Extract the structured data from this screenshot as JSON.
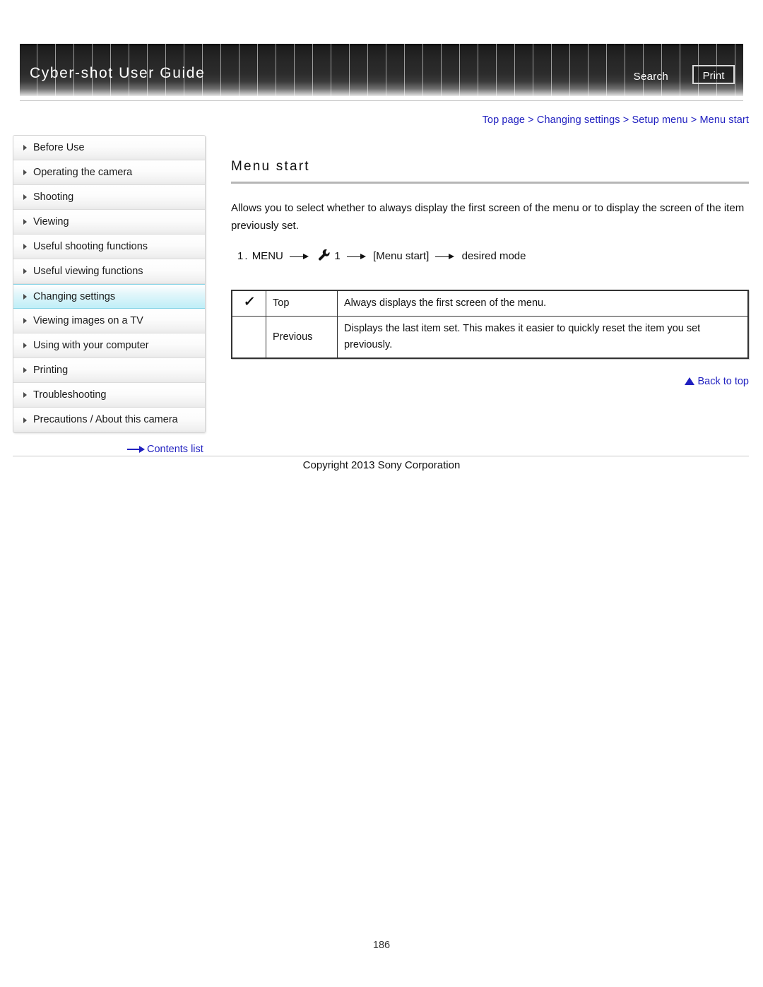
{
  "header": {
    "title": "Cyber-shot User Guide",
    "search_label": "Search",
    "print_label": "Print"
  },
  "breadcrumb": {
    "text": "Top page > Changing settings > Setup menu > Menu start"
  },
  "sidebar": {
    "items": [
      {
        "label": "Before Use",
        "active": false
      },
      {
        "label": "Operating the camera",
        "active": false
      },
      {
        "label": "Shooting",
        "active": false
      },
      {
        "label": "Viewing",
        "active": false
      },
      {
        "label": "Useful shooting functions",
        "active": false
      },
      {
        "label": "Useful viewing functions",
        "active": false
      },
      {
        "label": "Changing settings",
        "active": true
      },
      {
        "label": "Viewing images on a TV",
        "active": false
      },
      {
        "label": "Using with your computer",
        "active": false
      },
      {
        "label": "Printing",
        "active": false
      },
      {
        "label": "Troubleshooting",
        "active": false
      },
      {
        "label": "Precautions / About this camera",
        "active": false
      }
    ],
    "contents_list_label": "Contents list"
  },
  "main": {
    "title": "Menu start",
    "description": "Allows you to select whether to always display the first screen of the menu or to display the screen of the item previously set.",
    "step": {
      "number": "1.",
      "part1": "MENU",
      "wrench_label": "1",
      "part2": "[Menu start]",
      "part3": "desired mode"
    },
    "options": [
      {
        "checked": "✓",
        "name": "Top",
        "description": "Always displays the first screen of the menu."
      },
      {
        "checked": "",
        "name": "Previous",
        "description": "Displays the last item set. This makes it easier to quickly reset the item you set previously."
      }
    ],
    "back_to_top_label": "Back to top"
  },
  "footer": {
    "copyright": "Copyright 2013 Sony Corporation",
    "page_number": "186"
  },
  "colors": {
    "link": "#2020c0",
    "highlight": "#bfeef7",
    "rule": "#b6b6b6"
  }
}
